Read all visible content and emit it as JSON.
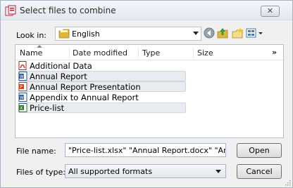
{
  "window": {
    "title": "Select files to combine",
    "close_label": "✕"
  },
  "lookin": {
    "label": "Look in:",
    "value": "English",
    "icons": [
      "folder-icon",
      "back-icon",
      "up-folder-icon",
      "new-folder-icon",
      "view-menu-icon"
    ]
  },
  "columns": {
    "name": "Name",
    "date": "Date modified",
    "type": "Type",
    "size": "Size",
    "more": "»"
  },
  "files": [
    {
      "name": "Additional Data",
      "icon": "pdf-icon",
      "selected": false
    },
    {
      "name": "Annual Report",
      "icon": "word-icon",
      "selected": true
    },
    {
      "name": "Annual Report Presentation",
      "icon": "powerpoint-icon",
      "selected": true
    },
    {
      "name": "Appendix to Annual Report",
      "icon": "word-icon",
      "selected": false
    },
    {
      "name": "Price-list",
      "icon": "excel-icon",
      "selected": true
    }
  ],
  "filename": {
    "label": "File name:",
    "value": "\"Price-list.xlsx\" \"Annual Report.docx\" \"Annual R"
  },
  "filetype": {
    "label": "Files of type:",
    "value": "All supported formats"
  },
  "buttons": {
    "open": "Open",
    "cancel": "Cancel"
  },
  "colors": {
    "pdf": "#d32f2f",
    "word": "#2b5797",
    "powerpoint": "#c84b1f",
    "excel": "#2e7d32",
    "folder": "#e0b53c"
  }
}
